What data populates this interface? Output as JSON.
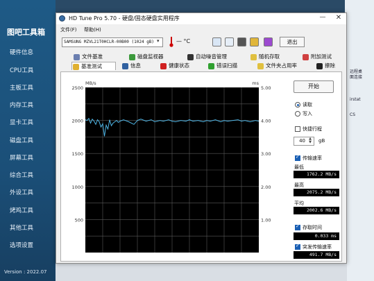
{
  "background_app": {
    "title": "图吧工具箱",
    "items": [
      "硬件信息",
      "CPU工具",
      "主板工具",
      "内存工具",
      "显卡工具",
      "磁盘工具",
      "屏幕工具",
      "综合工具",
      "外设工具",
      "烤鸡工具",
      "其他工具",
      "选项设置"
    ],
    "version": "Version : 2022.07",
    "right_edge_texts": [
      "远程桌",
      "面连接",
      "irstat",
      "CS"
    ]
  },
  "window": {
    "title": "HD Tune Pro 5.70 - 硬盘/固态硬盘实用程序",
    "min_glyph": "—",
    "close_glyph": "✕"
  },
  "menu": {
    "file": "文件(F)",
    "help": "帮助(H)"
  },
  "toolbar": {
    "drive": "SAMSUNG MZVL21T0HCLR-00B00 (1024 gB)",
    "temperature": "— °C",
    "exit_label": "退出",
    "icons": [
      "copy-icon",
      "copy-alt-icon",
      "camera-icon",
      "wrench-icon",
      "download-icon"
    ]
  },
  "tabs": {
    "row1": [
      "文件基准",
      "磁盘监视器",
      "自动噪音管理",
      "随机存取",
      "附加测试"
    ],
    "row2": [
      "基准测试",
      "信息",
      "健康状态",
      "错误扫描",
      "文件夹占用率",
      "擦除"
    ],
    "active": "基准测试"
  },
  "chart_data": {
    "type": "line",
    "y_left_unit": "MB/s",
    "y_right_unit": "ms",
    "y_left_ticks": [
      "2500",
      "2000",
      "1500",
      "1000",
      "500"
    ],
    "y_right_ticks": [
      "5.00",
      "4.00",
      "3.00",
      "2.00",
      "1.00"
    ],
    "ylim_left": [
      0,
      2500
    ],
    "ylim_right": [
      0,
      5
    ],
    "xlim": [
      0,
      100
    ],
    "grid": true,
    "series": [
      {
        "color": "#4fb6e6",
        "x": [
          0,
          1,
          2,
          3,
          4,
          5,
          6,
          7,
          8,
          9,
          10,
          11,
          12,
          13,
          14,
          15,
          16,
          17,
          18,
          19,
          20,
          22,
          25,
          28,
          30,
          32,
          35,
          38,
          40,
          43,
          45,
          48,
          50,
          52,
          55,
          58,
          60,
          62,
          65,
          68,
          70,
          72,
          75,
          78,
          80,
          82,
          85,
          88,
          90,
          92,
          95,
          98,
          100
        ],
        "y": [
          2010,
          2000,
          2030,
          1960,
          2020,
          1990,
          1940,
          2010,
          1980,
          1900,
          1950,
          1760,
          1930,
          1870,
          2010,
          1920,
          1960,
          1980,
          2000,
          1970,
          1990,
          2010,
          1980,
          1940,
          2000,
          2020,
          1990,
          2010,
          1980,
          2000,
          1990,
          2010,
          1990,
          1980,
          2000,
          1990,
          2010,
          1990,
          2000,
          1980,
          2000,
          1990,
          2010,
          1980,
          2000,
          1990,
          2000,
          2010,
          1990,
          2000,
          1980,
          2000,
          1990
        ]
      }
    ]
  },
  "controls": {
    "start_label": "开始",
    "read_label": "读取",
    "write_label": "写入",
    "short_stroke_label": "快捷行程",
    "short_stroke_value": "40",
    "short_stroke_unit": "gB",
    "transfer_rate_label": "传输速率",
    "min_label": "最低",
    "min_value": "1762.2 MB/s",
    "max_label": "最高",
    "max_value": "2075.2 MB/s",
    "avg_label": "平均",
    "avg_value": "2002.6 MB/s",
    "access_time_label": "存取时间",
    "access_time_value": "0.033 ms",
    "burst_rate_label": "突发传输速率",
    "burst_rate_value": "491.7 MB/s"
  }
}
